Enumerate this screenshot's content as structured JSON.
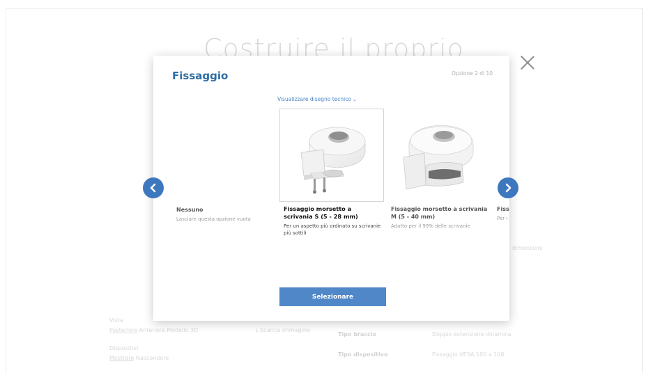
{
  "background": {
    "title": "Costruire il proprio",
    "view_label": "Vista",
    "view_tabs": [
      "Posteriore",
      "Anteriore",
      "Modello 3D"
    ],
    "download_label": "Scarica immagine",
    "devices_label": "Dispositivi",
    "device_actions": [
      "Mostrare",
      "Nascondere"
    ],
    "spec_rows": [
      {
        "label": "Tipo braccio",
        "value": "Doppio estensione dinamica"
      },
      {
        "label": "Tipo dispositivo",
        "value": "Fissaggio VESA 100 x 100"
      }
    ],
    "side_text": "dimensioni"
  },
  "modal": {
    "title": "Fissaggio",
    "option_count": "Opzione 2 di 10",
    "drawing_link": "Visualizzare disegno tecnico",
    "select_button": "Selezionare",
    "options": [
      {
        "title": "Nessuno",
        "description": "Lasciare questa opzione vuota"
      },
      {
        "title": "Fissaggio morsetto a scrivania S (5 - 28 mm)",
        "description": "Per un aspetto più ordinato su scrivanie più sottili"
      },
      {
        "title": "Fissaggio morsetto a scrivania M (5 - 40 mm)",
        "description": "Adatto per il 99% delle scrivanie"
      },
      {
        "title": "Fiss scri",
        "description": "Per i supe"
      }
    ]
  },
  "icons": {
    "close": "close-icon",
    "prev": "chevron-left-icon",
    "next": "chevron-right-icon",
    "drawing_chevron": "chevron-down-icon",
    "download": "download-icon"
  },
  "colors": {
    "accent": "#4f87c8",
    "title": "#2e6da4",
    "nav": "#3d77be"
  }
}
